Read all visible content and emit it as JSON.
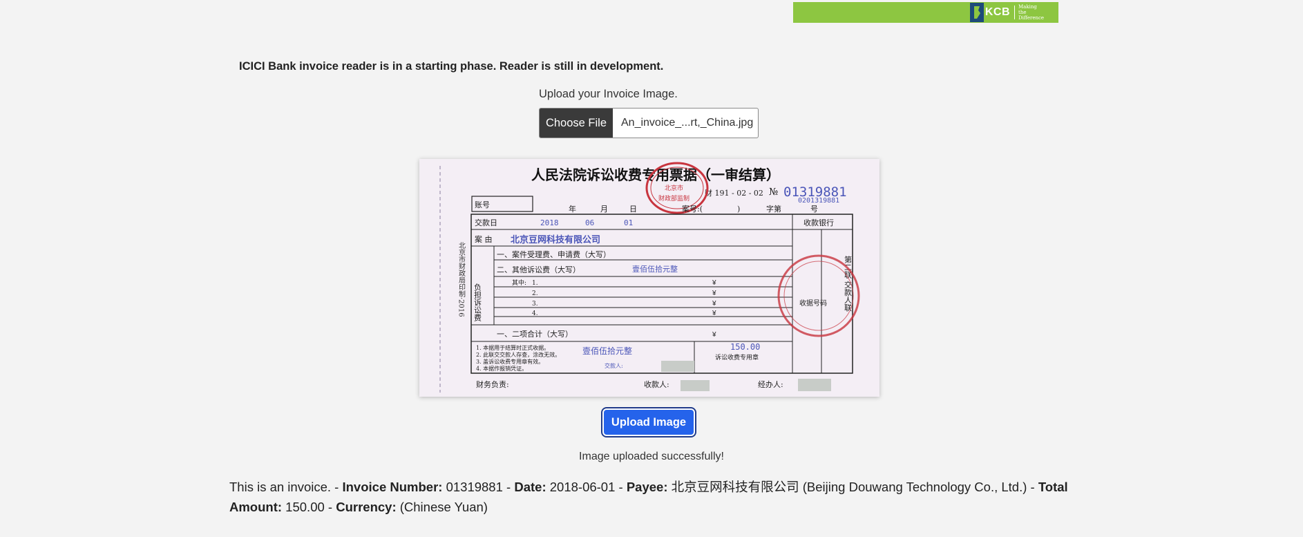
{
  "header": {
    "logo_text": "KCB",
    "logo_tagline": "Making the Difference",
    "brand_color": "#8dc641"
  },
  "notice": "ICICI Bank invoice reader is in a starting phase. Reader is still in development.",
  "upload": {
    "label": "Upload your Invoice Image.",
    "choose_label": "Choose File",
    "file_name": "An_invoice_...rt,_China.jpg",
    "button_label": "Upload Image",
    "button_color": "#2563eb"
  },
  "invoice_image": {
    "title": "人民法院诉讼收费专用票据（一审结算）",
    "serial_prefix": "№",
    "serial": "01319881",
    "serial_small": "0201319881",
    "code": "财 191 - 02 - 02",
    "account_label": "账号",
    "year_label": "年",
    "month_label": "月",
    "day_label": "日",
    "case_no_label": "案号:(",
    "case_no_close": ")",
    "char_label": "字第",
    "number_label": "号",
    "date_label": "交款日",
    "date_year": "2018",
    "date_month": "06",
    "date_day": "01",
    "bank_label": "收款银行",
    "reason_label": "案 由",
    "payer": "北京豆网科技有限公司",
    "row1": "一、案件受理费、申请费（大写）",
    "row2": "二、其他诉讼费（大写）",
    "row2_value": "壹佰伍拾元整",
    "sub_label": "其中:",
    "sub_rows": [
      "1.",
      "2.",
      "3.",
      "4."
    ],
    "yen": "¥",
    "burden_label": "负担诉讼费",
    "total_row": "一、二项合计（大写）",
    "total_value": "壹佰伍拾元整",
    "total_amount": "150.00",
    "notes": [
      "1. 本据用于结算时正式收据。",
      "2. 此联交交款人存查，涂改无效。",
      "3. 盖诉讼收费专用章有效。",
      "4. 本据作报销凭证。"
    ],
    "payer_sign": "交款人:",
    "stamp_label": "诉讼收费专用章",
    "receipt_no_label": "收据号码",
    "side_label": "第二联 交款人联",
    "footer_finance": "财务负责:",
    "footer_cashier": "收款人:",
    "footer_handler": "经办人:",
    "left_print": "北京市财政局印制·2016",
    "stamp_top": "北京市",
    "stamp_bottom": "财政部监制"
  },
  "status": "Image uploaded successfully!",
  "result": {
    "intro": "This is an invoice. - ",
    "invoice_number_label": "Invoice Number:",
    "invoice_number": " 01319881 - ",
    "date_label": "Date:",
    "date": " 2018-06-01 - ",
    "payee_label": "Payee:",
    "payee": " 北京豆网科技有限公司 (Beijing Douwang Technology Co., Ltd.) - ",
    "total_label": "Total Amount:",
    "total": " 150.00 - ",
    "currency_label": "Currency:",
    "currency": " (Chinese Yuan)"
  }
}
